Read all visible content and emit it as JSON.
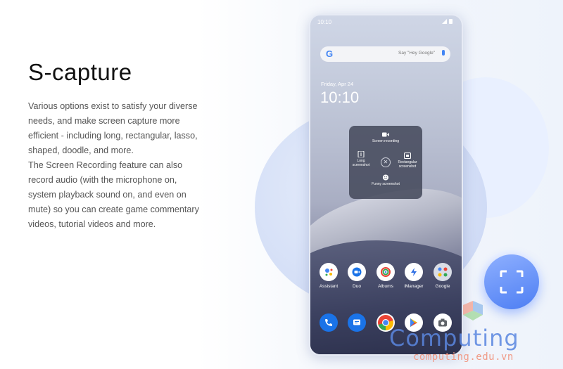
{
  "heading": "S-capture",
  "description": {
    "p1": "Various options exist to satisfy your diverse needs, and make screen capture more efficient - including long, rectangular, lasso, shaped, doodle, and more.",
    "p2": "The Screen Recording feature can also record audio (with the microphone on, system playback sound on, and even on mute) so you can create game commentary videos, tutorial videos and more."
  },
  "phone": {
    "status_time": "10:10",
    "search_hint": "Say \"Hey Google\"",
    "search_logo": "G",
    "date": "Friday, Apr 24",
    "clock": "10:10",
    "capture_menu": {
      "screen_recording": "Screen recording",
      "long_screenshot": "Long screenshot",
      "rectangular_screenshot": "Rectangular screenshot",
      "funny_screenshot": "Funny screenshot",
      "close_symbol": "✕"
    },
    "apps_row1": [
      {
        "label": "Assistant",
        "icon": "assistant-icon"
      },
      {
        "label": "Duo",
        "icon": "duo-icon"
      },
      {
        "label": "Albums",
        "icon": "albums-icon"
      },
      {
        "label": "iManager",
        "icon": "imanager-icon"
      },
      {
        "label": "Google",
        "icon": "google-folder-icon"
      }
    ],
    "dock": [
      {
        "icon": "phone-icon"
      },
      {
        "icon": "messages-icon"
      },
      {
        "icon": "chrome-icon"
      },
      {
        "icon": "play-store-icon"
      },
      {
        "icon": "camera-icon"
      }
    ]
  },
  "watermark": {
    "brand": "Computing",
    "url": "computing.edu.vn"
  },
  "colors": {
    "accent": "#4d7ef3",
    "text": "#555555",
    "heading": "#111111"
  }
}
